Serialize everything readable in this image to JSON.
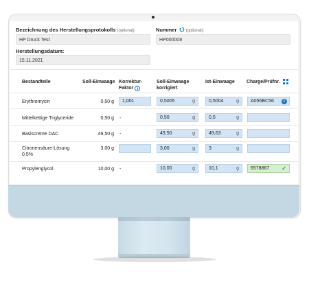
{
  "form": {
    "protocol_label": "Bezeichnung des Herstellungsprotokolls",
    "protocol_optional": "(optional):",
    "protocol_value": "HP Druck Test",
    "number_label": "Nummer",
    "number_optional": "(optional):",
    "number_value": "HP000008",
    "date_label": "Herstellungsdatum:",
    "date_value": "15.11.2021"
  },
  "table": {
    "headers": {
      "component": "Bestandteile",
      "target_weight": "Soll-Einwaage",
      "correction_factor_1": "Korrektur-",
      "correction_factor_2": "Faktor",
      "target_corrected_1": "Soll-Einwaage",
      "target_corrected_2": "korrigiert",
      "actual_weight": "Ist-Einwaage",
      "batch": "Charge/Prüfnr."
    },
    "rows": [
      {
        "name": "Erythromycin",
        "name2": "",
        "target": "0,50 g",
        "factor": "1,001",
        "corrected": "0,5005",
        "corrected_unit": "g",
        "actual": "0,5004",
        "actual_unit": "g",
        "batch": "A056BC56"
      },
      {
        "name": "Mittelkettige Triglyceride",
        "name2": "",
        "target": "0,50 g",
        "factor": "-",
        "corrected": "0,50",
        "corrected_unit": "g",
        "actual": "0,5",
        "actual_unit": "g",
        "batch": ""
      },
      {
        "name": "Basiscreme DAC",
        "name2": "",
        "target": "49,50 g",
        "factor": "-",
        "corrected": "49,50",
        "corrected_unit": "g",
        "actual": "49,63",
        "actual_unit": "g",
        "batch": ""
      },
      {
        "name": "Citronensäure-Lösung",
        "name2": "0,5%",
        "target": "3,00 g",
        "factor": "",
        "corrected": "3,00",
        "corrected_unit": "g",
        "actual": "3",
        "actual_unit": "g",
        "batch": ""
      },
      {
        "name": "Propylenglycol",
        "name2": "",
        "target": "10,00 g",
        "factor": "-",
        "corrected": "10,00",
        "corrected_unit": "g",
        "actual": "10,1",
        "actual_unit": "g",
        "batch": "6578867"
      }
    ]
  },
  "icons": {
    "refresh": "refresh-icon",
    "info": "info-icon",
    "grid": "grid-icon",
    "check": "check-icon"
  },
  "colors": {
    "accent": "#1b74c9",
    "input_bg": "#d3e5f4",
    "success_bg": "#d6efd2",
    "stand": "#c4d8e3"
  }
}
